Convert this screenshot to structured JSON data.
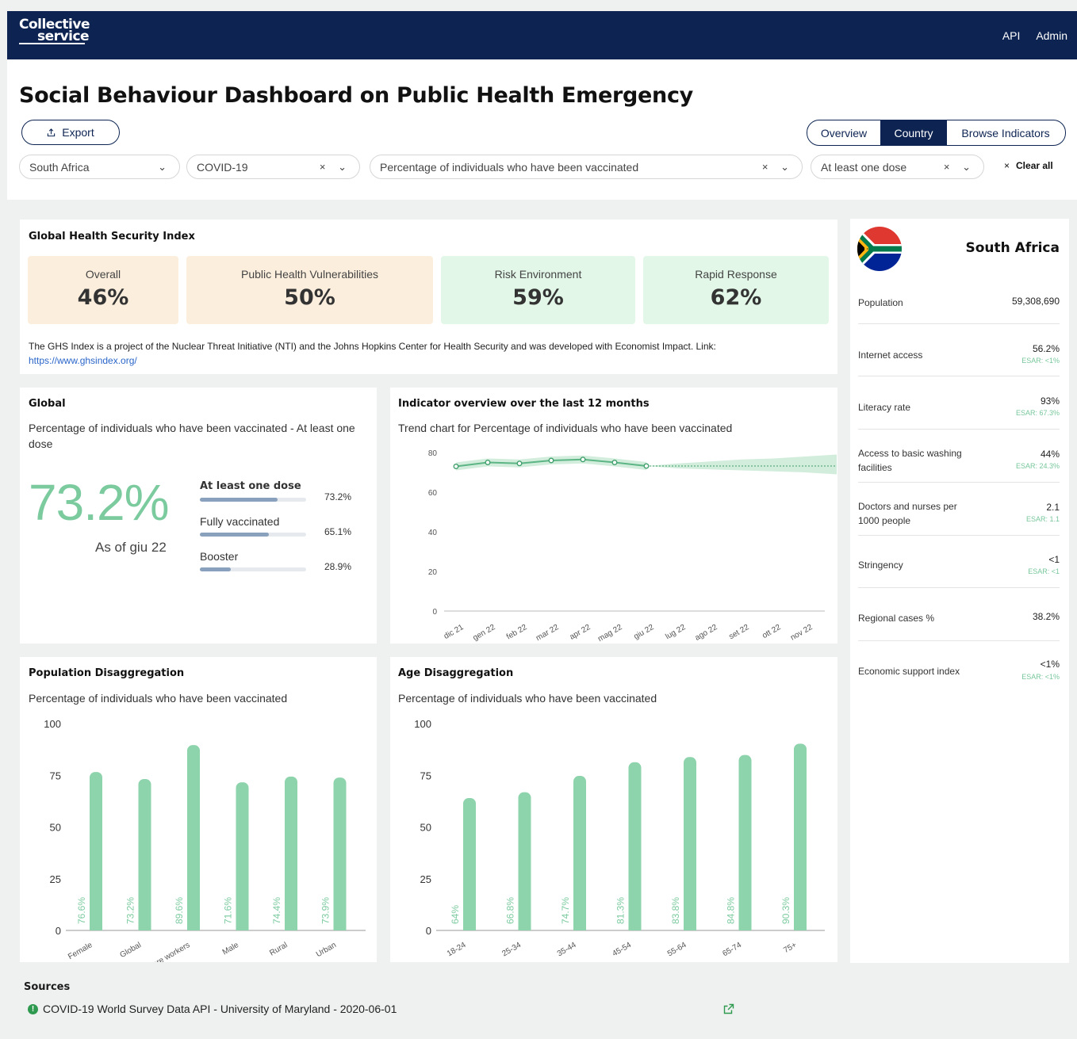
{
  "nav": {
    "logo_line1": "Collective",
    "logo_line2": "service",
    "links": [
      "API",
      "Admin"
    ]
  },
  "header": {
    "title": "Social Behaviour Dashboard on Public Health Emergency",
    "export_label": "Export",
    "views": [
      "Overview",
      "Country",
      "Browse Indicators"
    ],
    "active_view": "Country",
    "filters": {
      "country": "South Africa",
      "emergency": "COVID-19",
      "indicator": "Percentage of individuals who have been vaccinated",
      "dose": "At least one dose"
    },
    "clear_all": "Clear all"
  },
  "ghs": {
    "title": "Global Health Security Index",
    "boxes": [
      {
        "label": "Overall",
        "value": "46%"
      },
      {
        "label": "Public Health Vulnerabilities",
        "value": "50%"
      },
      {
        "label": "Risk Environment",
        "value": "59%"
      },
      {
        "label": "Rapid Response",
        "value": "62%"
      }
    ],
    "note": "The GHS Index is a project of the Nuclear Threat Initiative (NTI) and the Johns Hopkins Center for Health Security and was developed with Economist Impact. Link:",
    "link": "https://www.ghsindex.org/"
  },
  "global": {
    "title": "Global",
    "subtitle": "Percentage of individuals who have been vaccinated - At least one dose",
    "big_value": "73.2%",
    "as_of": "As of giu 22",
    "doses": [
      {
        "label": "At least one dose",
        "value": "73.2%",
        "pct": 73.2
      },
      {
        "label": "Fully vaccinated",
        "value": "65.1%",
        "pct": 65.1
      },
      {
        "label": "Booster",
        "value": "28.9%",
        "pct": 28.9
      }
    ]
  },
  "country_panel": {
    "name": "South Africa",
    "rows": [
      {
        "label": "Population",
        "value": "59,308,690",
        "esar": ""
      },
      {
        "label": "Internet access",
        "value": "56.2%",
        "esar": "ESAR: <1%"
      },
      {
        "label": "Literacy rate",
        "value": "93%",
        "esar": "ESAR: 67.3%"
      },
      {
        "label": "Access to basic washing facilities",
        "value": "44%",
        "esar": "ESAR: 24.3%"
      },
      {
        "label": "Doctors and nurses per 1000 people",
        "value": "2.1",
        "esar": "ESAR: 1.1"
      },
      {
        "label": "Stringency",
        "value": "<1",
        "esar": "ESAR: <1"
      },
      {
        "label": "Regional cases %",
        "value": "38.2%",
        "esar": ""
      },
      {
        "label": "Economic support index",
        "value": "<1%",
        "esar": "ESAR: <1%"
      }
    ]
  },
  "sources": {
    "title": "Sources",
    "items": [
      "COVID-19 World Survey Data API - University of Maryland - 2020-06-01"
    ]
  },
  "chart_data": [
    {
      "type": "line",
      "title": "Indicator overview over the last 12 months",
      "subtitle": "Trend chart for Percentage of individuals who have been vaccinated",
      "x": [
        "dic 21",
        "gen 22",
        "feb 22",
        "mar 22",
        "apr 22",
        "mag 22",
        "giu 22",
        "lug 22",
        "ago 22",
        "set 22",
        "ott 22",
        "nov 22"
      ],
      "series": [
        {
          "values": [
            73,
            75,
            74.5,
            76,
            76.5,
            75,
            73.2,
            null,
            null,
            null,
            null,
            null
          ]
        }
      ],
      "projection": {
        "value": 73.2,
        "band_low": [
          72,
          71.5,
          71,
          70.5,
          70,
          69
        ],
        "band_high": [
          74.5,
          75.5,
          76.5,
          77,
          78,
          79
        ]
      },
      "ylim": [
        0,
        80
      ],
      "yticks": [
        0,
        20,
        40,
        60,
        80
      ]
    },
    {
      "type": "bar",
      "title": "Population Disaggregation",
      "subtitle": "Percentage of individuals who have been vaccinated",
      "categories": [
        "Female",
        "Global",
        "Healthcare workers",
        "Male",
        "Rural",
        "Urban"
      ],
      "values": [
        76.6,
        73.2,
        89.6,
        71.6,
        74.4,
        73.9
      ],
      "labels": [
        "76.6%",
        "73.2%",
        "89.6%",
        "71.6%",
        "74.4%",
        "73.9%"
      ],
      "ylim": [
        0,
        100
      ],
      "yticks": [
        0,
        25,
        50,
        75,
        100
      ]
    },
    {
      "type": "bar",
      "title": "Age Disaggregation",
      "subtitle": "Percentage of individuals who have been vaccinated",
      "categories": [
        "18-24",
        "25-34",
        "35-44",
        "45-54",
        "55-64",
        "65-74",
        "75+"
      ],
      "values": [
        64,
        66.8,
        74.7,
        81.3,
        83.8,
        84.8,
        90.3
      ],
      "labels": [
        "64%",
        "66.8%",
        "74.7%",
        "81.3%",
        "83.8%",
        "84.8%",
        "90.3%"
      ],
      "ylim": [
        0,
        100
      ],
      "yticks": [
        0,
        25,
        50,
        75,
        100
      ]
    }
  ],
  "colors": {
    "navy": "#0d2452",
    "green": "#7ccb9f",
    "tan": "#fbeedc",
    "mint": "#e2f7e8"
  }
}
